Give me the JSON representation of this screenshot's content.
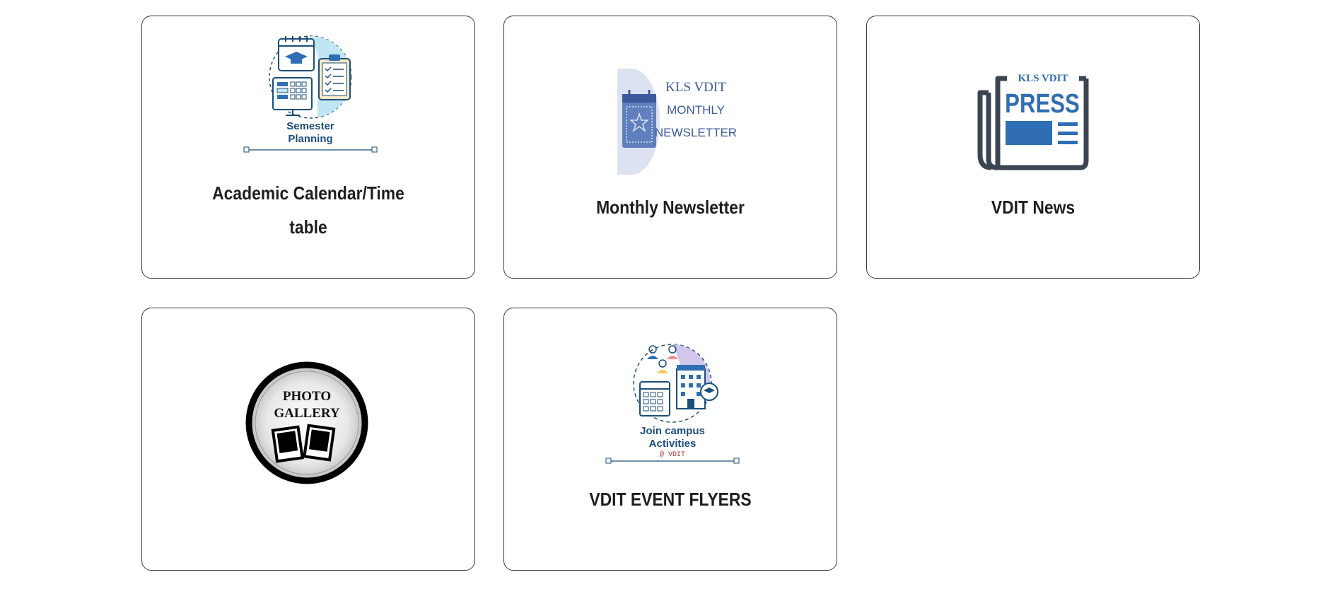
{
  "cards": [
    {
      "title": "Academic Calendar/Time table",
      "title_line1": "Academic Calendar/Time",
      "title_line2": "table",
      "image_caption": {
        "line1": "Semester",
        "line2": "Planning"
      },
      "icon": "semester-planning-icon"
    },
    {
      "title": "Monthly Newsletter",
      "image_caption": {
        "line1": "KLS VDIT",
        "line2": "MONTHLY",
        "line3": "NEWSLETTER"
      },
      "icon": "newsletter-calendar-icon"
    },
    {
      "title": "VDIT News",
      "image_caption": {
        "line1": "KLS VDIT",
        "line2": "PRESS"
      },
      "icon": "newspaper-press-icon"
    },
    {
      "title": "",
      "image_caption": {
        "line1": "PHOTO",
        "line2": "GALLERY"
      },
      "icon": "photo-gallery-icon"
    },
    {
      "title": "VDIT EVENT FLYERS",
      "image_caption": {
        "line1": "Join campus",
        "line2": "Activities",
        "line3": "@ VDIT"
      },
      "icon": "campus-activities-icon"
    }
  ],
  "colors": {
    "primary_blue": "#2f6eb5",
    "dark_teal": "#1d4f7a",
    "light_cyan": "#bfe6f2",
    "lavender": "#d3c6ec",
    "border": "#3a3a3a",
    "title_text": "#1e1e1e"
  }
}
